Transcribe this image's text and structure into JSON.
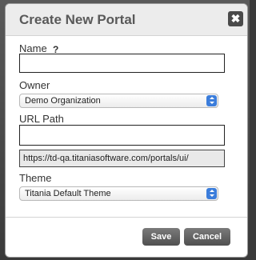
{
  "dialog": {
    "title": "Create New Portal",
    "close_glyph": "✖"
  },
  "form": {
    "name_label": "Name",
    "name_help": "?",
    "name_value": "",
    "owner_label": "Owner",
    "owner_selected": "Demo Organization",
    "url_label": "URL Path",
    "url_value": "",
    "url_preview": "https://td-qa.titaniasoftware.com/portals/ui/",
    "theme_label": "Theme",
    "theme_selected": "Titania Default Theme"
  },
  "buttons": {
    "save": "Save",
    "cancel": "Cancel"
  },
  "colors": {
    "accent": "#3b7ddb",
    "button": "#5f5f5f"
  }
}
